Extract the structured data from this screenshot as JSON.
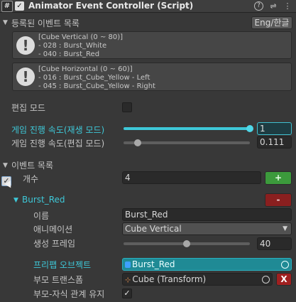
{
  "header": {
    "icon_glyph": "#",
    "enabled_check": "✓",
    "title": "Animator Event Controller (Script)",
    "help_icon": "?",
    "settings_icon": "⇌",
    "menu_icon": "⋮"
  },
  "registered_events": {
    "label": "등록된 이벤트 목록",
    "lang_button": "Eng/한글",
    "boxes": [
      {
        "icon": "!",
        "lines": [
          "[Cube Vertical (0 ~ 80)]",
          "- 028 : Burst_White",
          "- 040 : Burst_Red"
        ]
      },
      {
        "icon": "!",
        "lines": [
          "[Cube Horizontal (0 ~ 60)]",
          "- 016 : Burst_Cube_Yellow - Left",
          "- 045 : Burst_Cube_Yellow - Right"
        ]
      }
    ]
  },
  "edit_mode": {
    "label": "편집 모드",
    "checked": false
  },
  "play_speed": {
    "label": "게임 진행 속도(재생 모드)",
    "value": "1",
    "fraction": 1.0
  },
  "edit_speed": {
    "label": "게임 진행 속도(편집 모드)",
    "value": "0.111",
    "fraction": 0.111
  },
  "event_list": {
    "label": "이벤트 목록",
    "count_label": "개수",
    "count_value": "4",
    "add_button": "+"
  },
  "event_item": {
    "checked_glyph": "✓",
    "name": "Burst_Red",
    "remove_button": "-",
    "name_label": "이름",
    "name_value": "Burst_Red",
    "animation_label": "애니메이션",
    "animation_value": "Cube Vertical",
    "frame_label": "생성 프레임",
    "frame_value": "40",
    "frame_fraction": 0.5,
    "prefab_label": "프리팹 오브젝트",
    "prefab_value": "Burst_Red",
    "parent_label": "부모 트랜스폼",
    "parent_value": "Cube (Transform)",
    "parent_clear": "X",
    "keep_relation_label": "부모-자식 관계 유지",
    "keep_relation_glyph": "✓"
  },
  "colors": {
    "accent_cyan": "#3ec8d8",
    "add_green": "#3c9a3c",
    "remove_red": "#8a1f1f",
    "clear_red": "#a02020"
  }
}
